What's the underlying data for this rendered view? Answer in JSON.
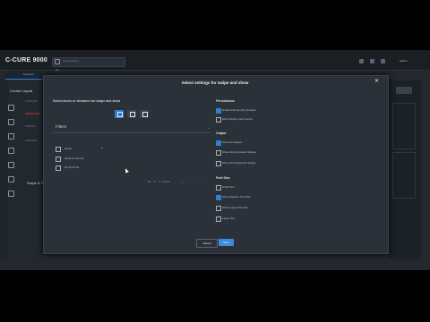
{
  "app": {
    "brand": "C-CURE 9000",
    "brand_tab": "Dynamic",
    "search_placeholder": "Find anything",
    "sub_label": "All",
    "user": "Admin"
  },
  "background": {
    "create_title": "Create Layout",
    "swipe_label": "Swipe & Sh"
  },
  "modal": {
    "title": "Select settings for swipe and show",
    "left_heading": "Select doors or elevators for swipe and show",
    "filters_label": "Filters",
    "name_column": "Name",
    "name_extra": "E",
    "items": [
      {
        "label": "All Doors Group",
        "checked": false
      },
      {
        "label": "All CCTV IN",
        "checked": false
      }
    ],
    "pager": {
      "page_size": "10",
      "range": "1 - 0 of 0"
    },
    "permissions": {
      "heading": "Permissions",
      "options": [
        {
          "label": "Enable Filtering By Operator",
          "checked": true
        },
        {
          "label": "Show Single Card Layout",
          "checked": false
        }
      ]
    },
    "output": {
      "heading": "Output",
      "options": [
        {
          "label": "Show All Swipes",
          "checked": true
        },
        {
          "label": "Show Only Accepted Swipes",
          "checked": false
        },
        {
          "label": "Show Only Rejected Swipes",
          "checked": false
        }
      ]
    },
    "font_size": {
      "heading": "Font Size",
      "options": [
        {
          "label": "Small Text",
          "checked": false
        },
        {
          "label": "Show Medium Text Size",
          "checked": true
        },
        {
          "label": "Show Large Text Size",
          "checked": false
        },
        {
          "label": "Large Text",
          "checked": false
        }
      ]
    },
    "buttons": {
      "cancel": "Cancel",
      "save": "Save"
    }
  },
  "colors": {
    "accent": "#2f7fd6",
    "modal_bg": "#2b3138",
    "app_bg": "#23282e"
  }
}
